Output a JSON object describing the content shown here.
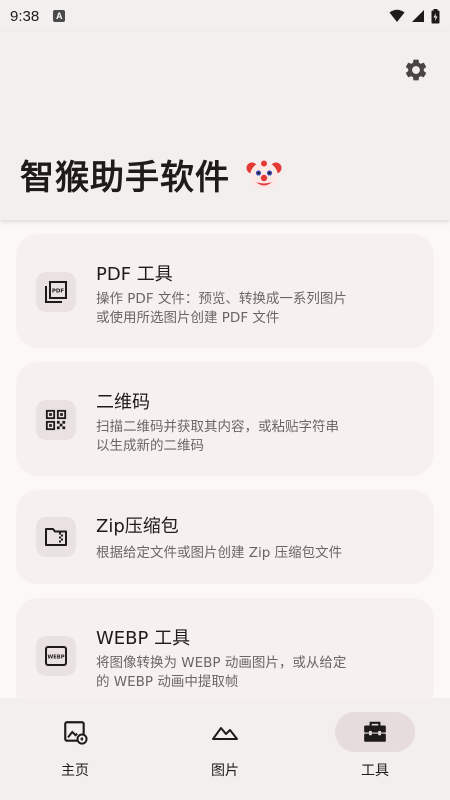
{
  "status_bar": {
    "time": "9:38",
    "notification_icon": "A"
  },
  "header": {
    "settings_icon": "gear-icon",
    "title": "智猴助手软件",
    "title_emoji": "clown-face"
  },
  "cards": [
    {
      "icon": "pdf-icon",
      "title": "PDF 工具",
      "description_line1": "操作 PDF 文件：预览、转换成一系列图片",
      "description_line2": "或使用所选图片创建 PDF 文件"
    },
    {
      "icon": "qr-code-icon",
      "title": "二维码",
      "description_line1": "扫描二维码并获取其内容，或粘贴字符串",
      "description_line2": "以生成新的二维码"
    },
    {
      "icon": "zip-folder-icon",
      "title": "Zip压缩包",
      "description_line1": "根据给定文件或图片创建 Zip 压缩包文件",
      "description_line2": ""
    },
    {
      "icon": "webp-icon",
      "title": "WEBP 工具",
      "description_line1": "将图像转换为 WEBP 动画图片，或从给定",
      "description_line2": "的 WEBP 动画中提取帧"
    }
  ],
  "bottom_nav": {
    "items": [
      {
        "label": "主页",
        "icon": "home-image-icon"
      },
      {
        "label": "图片",
        "icon": "landscape-icon"
      },
      {
        "label": "工具",
        "icon": "toolbox-icon",
        "active": true
      }
    ]
  },
  "colors": {
    "background": "#fcf8f7",
    "header": "#f3efee",
    "card": "#f6f1f0",
    "icon_bg": "#e9e2e0",
    "active_nav": "#e6dcdb",
    "text": "#1f1b1a",
    "secondary_text": "#6d6563"
  }
}
